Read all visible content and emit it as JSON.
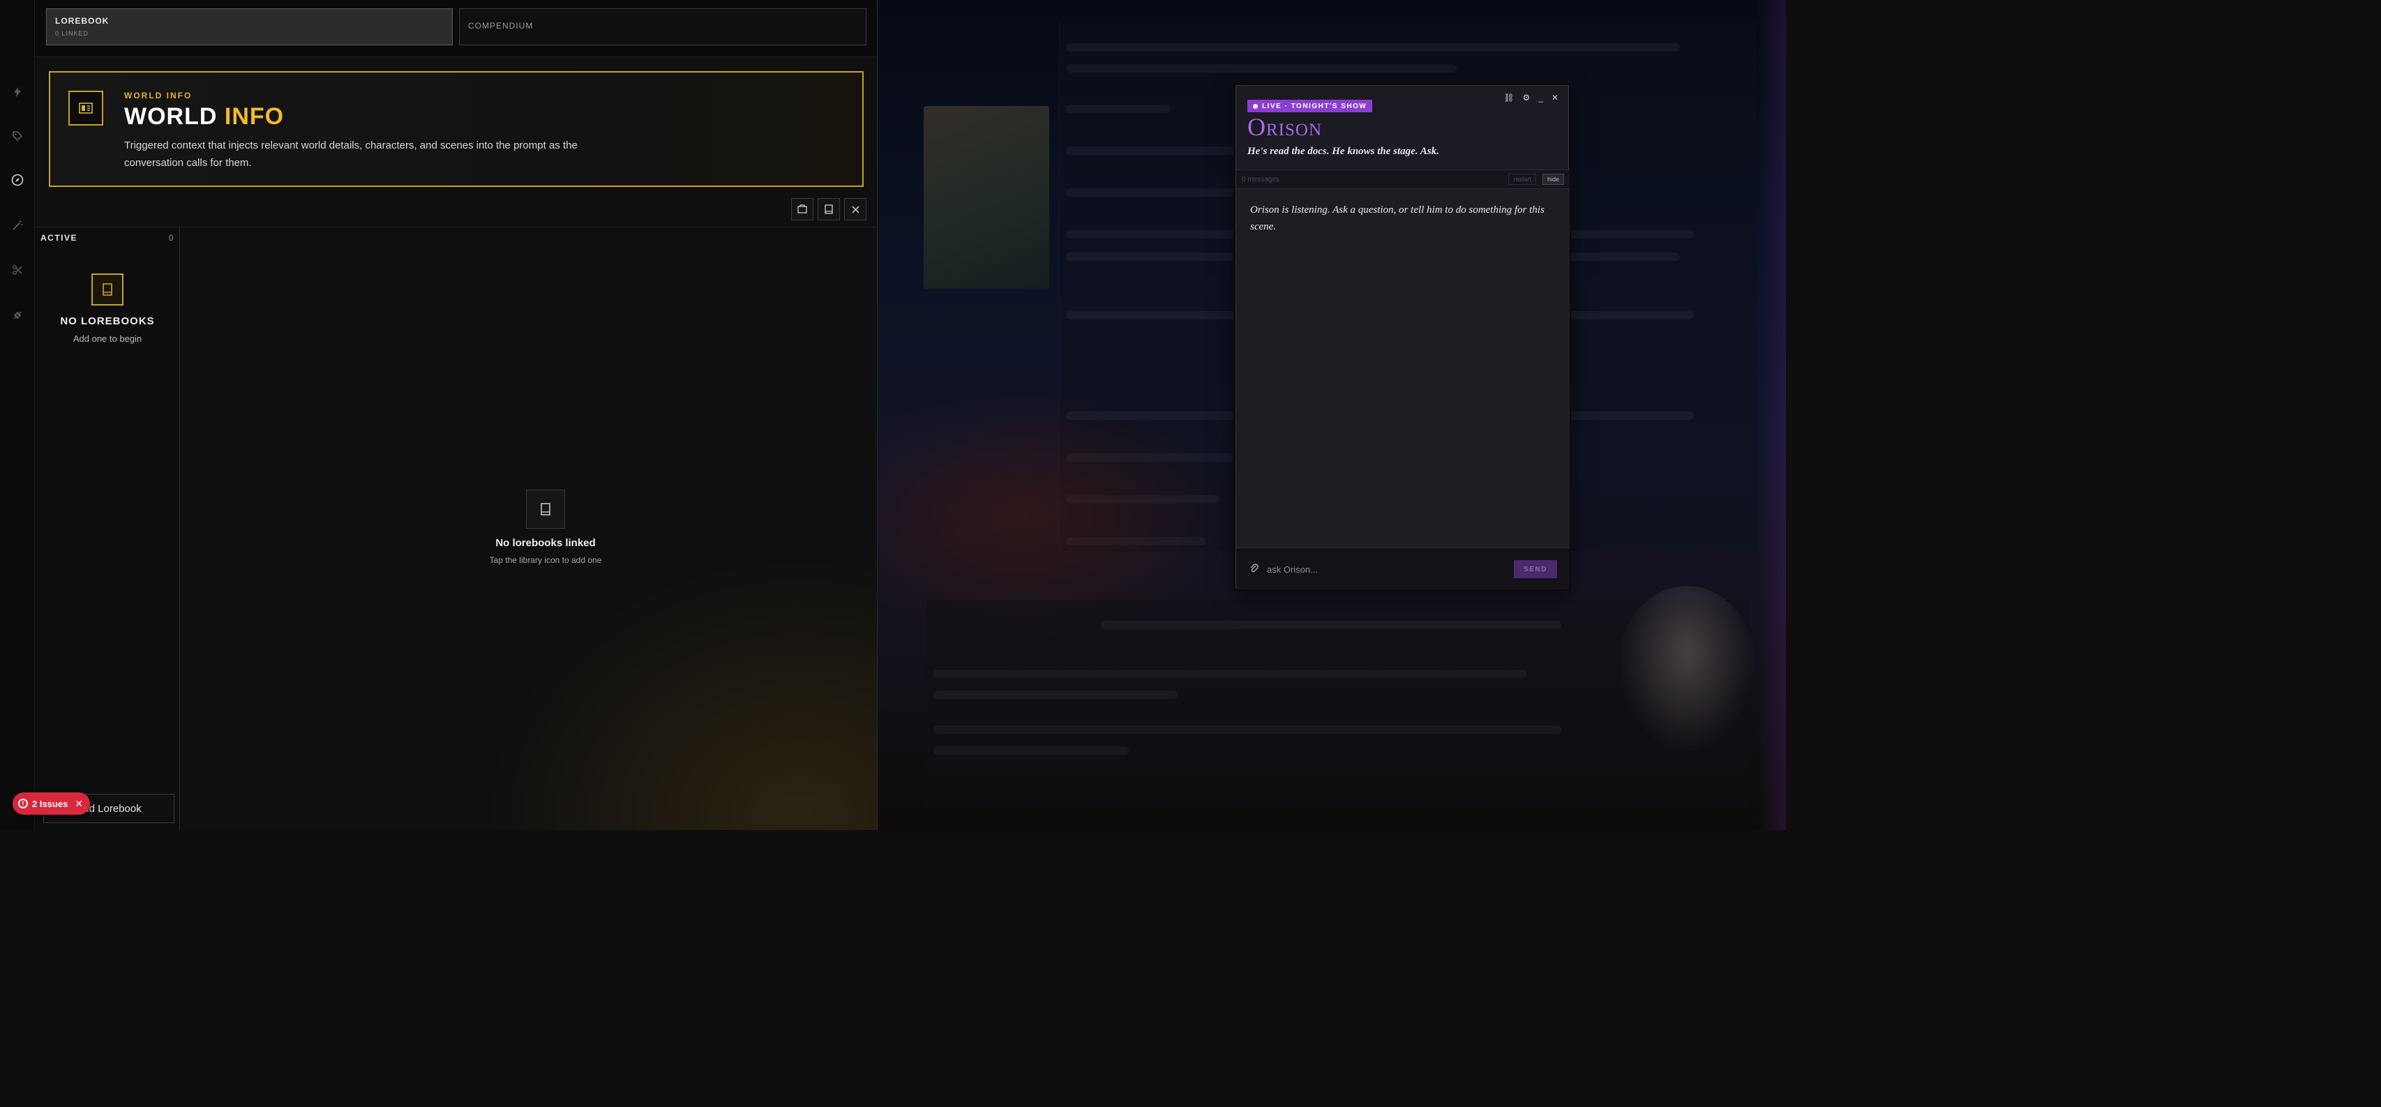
{
  "tabs": [
    {
      "label": "LOREBOOK",
      "sub": "0 LINKED"
    },
    {
      "label": "COMPENDIUM",
      "sub": ""
    }
  ],
  "rail_icons": [
    "bolt-icon",
    "tag-icon",
    "compass-icon",
    "wand-icon",
    "scissors-icon",
    "plug-icon"
  ],
  "hero": {
    "eyebrow": "WORLD INFO",
    "title_main": "WORLD",
    "title_accent": "INFO",
    "description": "Triggered context that injects relevant world details, characters, and scenes into the prompt as the conversation calls for them."
  },
  "sidebar": {
    "heading": "ACTIVE",
    "count": "0",
    "empty_title": "NO LOREBOOKS",
    "empty_sub": "Add one to begin",
    "add_label": "Add Lorebook"
  },
  "main": {
    "empty_title": "No lorebooks linked",
    "empty_sub": "Tap the library icon to add one"
  },
  "issues": {
    "label": "2 Issues"
  },
  "widget": {
    "live_label": "LIVE · TONIGHT'S SHOW",
    "name": "Orison",
    "tagline": "He's read the docs. He knows the stage. Ask.",
    "message_count": "0 messages",
    "restart_label": "restart",
    "hide_label": "hide",
    "intro_message": "Orison is listening. Ask a question, or tell him to do something for this scene.",
    "input_placeholder": "ask Orison...",
    "send_label": "SEND",
    "accent_color": "#a86ae6"
  },
  "colors": {
    "gold": "#c9a227",
    "issue_red": "#d8283b",
    "live_purple": "#8a3fd0"
  }
}
